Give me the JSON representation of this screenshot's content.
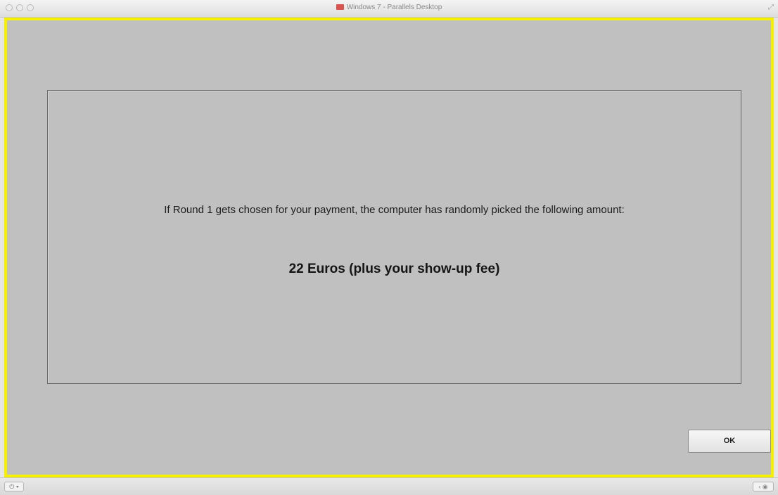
{
  "window": {
    "title": "Windows 7 - Parallels Desktop"
  },
  "dialog": {
    "message": "If Round 1 gets chosen for your payment, the computer has randomly picked the following amount:",
    "amount": "22 Euros (plus your show-up fee)",
    "ok_label": "OK"
  },
  "colors": {
    "vm_border": "#f6f000",
    "background": "#c0c0c0"
  },
  "icons": {
    "title_icon": "parallels-icon",
    "power": "power-icon",
    "status_right": "devices-icon"
  }
}
